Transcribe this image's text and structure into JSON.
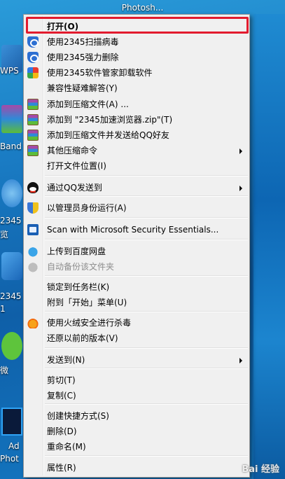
{
  "desktop": {
    "window_title": "Photosh...",
    "icon_labels": [
      "WPS",
      "Band",
      "2345",
      "览",
      "2345",
      "1",
      "微",
      "Ad",
      "Phot"
    ]
  },
  "menu": {
    "items": [
      {
        "label": "打开(O)",
        "icon": "none",
        "bold": true
      },
      {
        "label": "使用2345扫描病毒",
        "icon": "shield-icon"
      },
      {
        "label": "使用2345强力删除",
        "icon": "shield-icon"
      },
      {
        "label": "使用2345软件管家卸载软件",
        "icon": "colorful-app-icon"
      },
      {
        "label": "兼容性疑难解答(Y)",
        "icon": "none"
      },
      {
        "label": "添加到压缩文件(A) ...",
        "icon": "winrar-icon"
      },
      {
        "label": "添加到 \"2345加速浏览器.zip\"(T)",
        "icon": "winrar-icon"
      },
      {
        "label": "添加到压缩文件并发送给QQ好友",
        "icon": "winrar-icon"
      },
      {
        "label": "其他压缩命令",
        "icon": "winrar-icon",
        "submenu": true
      },
      {
        "label": "打开文件位置(I)",
        "icon": "none"
      },
      {
        "label": "通过QQ发送到",
        "icon": "qq-icon",
        "submenu": true
      },
      {
        "label": "以管理员身份运行(A)",
        "icon": "uac-shield-icon"
      },
      {
        "label": "Scan with Microsoft Security Essentials...",
        "icon": "mse-icon"
      },
      {
        "label": "上传到百度网盘",
        "icon": "baidu-cloud-icon"
      },
      {
        "label": "自动备份该文件夹",
        "icon": "baidu-cloud-gray-icon",
        "disabled": true
      },
      {
        "label": "锁定到任务栏(K)",
        "icon": "none"
      },
      {
        "label": "附到「开始」菜单(U)",
        "icon": "none"
      },
      {
        "label": "使用火绒安全进行杀毒",
        "icon": "huorong-icon"
      },
      {
        "label": "还原以前的版本(V)",
        "icon": "none"
      },
      {
        "label": "发送到(N)",
        "icon": "none",
        "submenu": true
      },
      {
        "label": "剪切(T)",
        "icon": "none"
      },
      {
        "label": "复制(C)",
        "icon": "none"
      },
      {
        "label": "创建快捷方式(S)",
        "icon": "none"
      },
      {
        "label": "删除(D)",
        "icon": "none"
      },
      {
        "label": "重命名(M)",
        "icon": "none"
      },
      {
        "label": "属性(R)",
        "icon": "none"
      }
    ]
  },
  "colors": {
    "highlight_border": "#e21b2e",
    "menu_bg": "#f0f0f0"
  },
  "watermark": "Bai 经验"
}
